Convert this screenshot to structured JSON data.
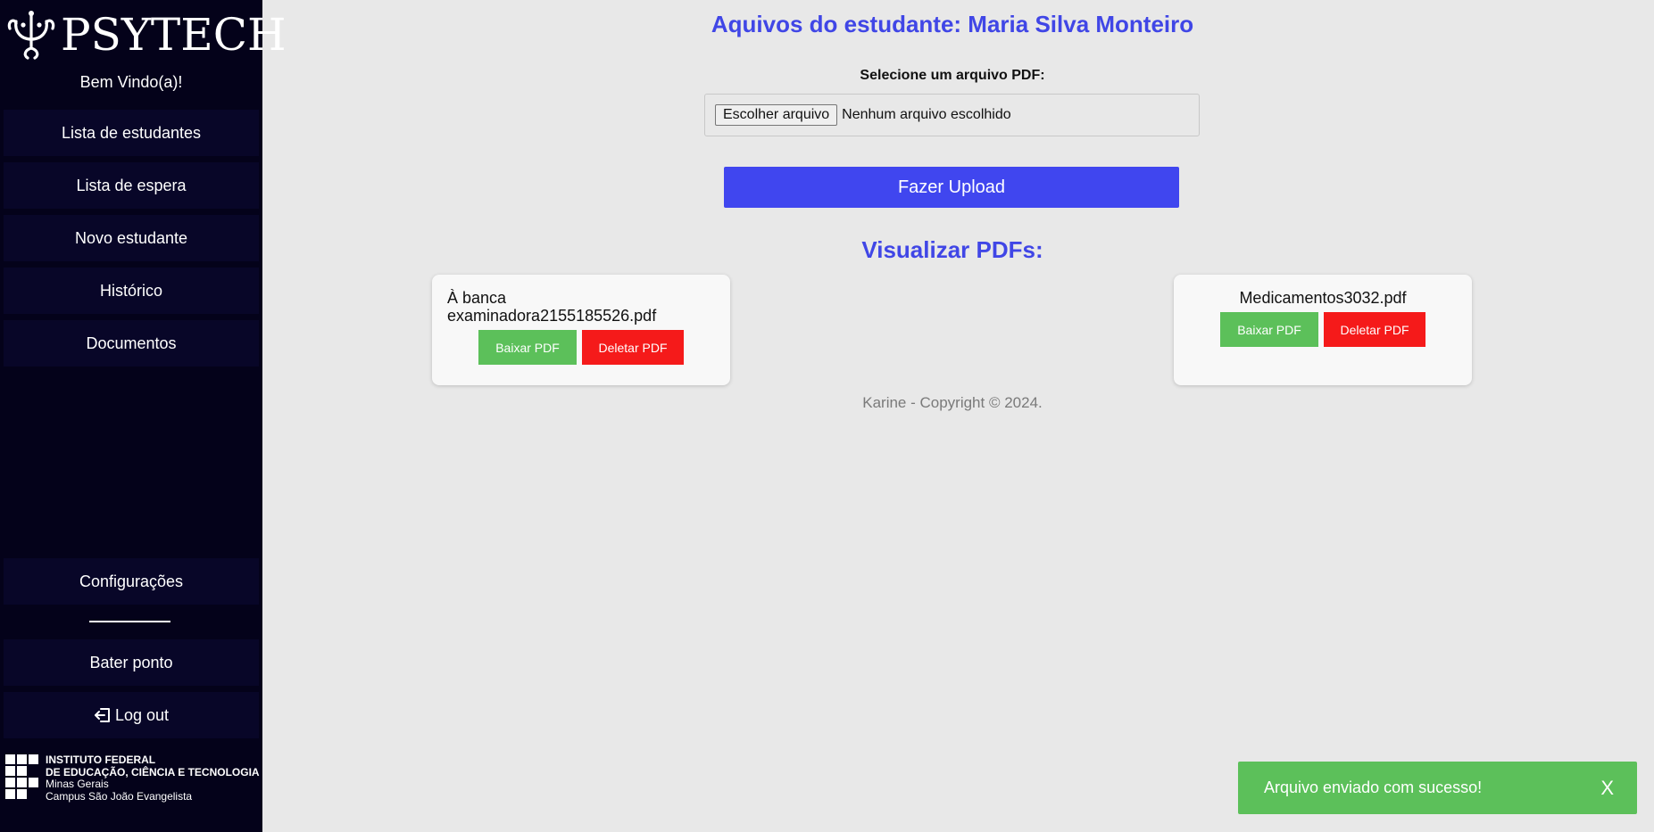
{
  "sidebar": {
    "brand": "PSYTECH",
    "welcome": "Bem Vindo(a)!",
    "nav": [
      {
        "label": "Lista de estudantes"
      },
      {
        "label": "Lista de espera"
      },
      {
        "label": "Novo estudante"
      },
      {
        "label": "Histórico"
      },
      {
        "label": "Documentos"
      }
    ],
    "settings_label": "Configurações",
    "clock_in_label": "Bater ponto",
    "logout_label": "Log out",
    "institution": {
      "line1": "INSTITUTO FEDERAL",
      "line2": "DE EDUCAÇÃO, CIÊNCIA E TECNOLOGIA",
      "line3": "Minas Gerais",
      "line4": "Campus São João Evangelista"
    }
  },
  "main": {
    "title": "Aquivos do estudante: Maria Silva Monteiro",
    "upload": {
      "label": "Selecione um arquivo PDF:",
      "choose_button": "Escolher arquivo",
      "no_file": "Nenhum arquivo escolhido",
      "submit_label": "Fazer Upload"
    },
    "pdfs_title": "Visualizar PDFs:",
    "pdfs": [
      {
        "name": "À banca examinadora2155185526.pdf",
        "download_label": "Baixar PDF",
        "delete_label": "Deletar PDF"
      },
      {
        "name": "Medicamentos3032.pdf",
        "download_label": "Baixar PDF",
        "delete_label": "Deletar PDF"
      }
    ],
    "footer": "Karine - Copyright © 2024."
  },
  "toast": {
    "message": "Arquivo enviado com sucesso!",
    "close": "X"
  },
  "colors": {
    "sidebar_bg": "#04021a",
    "accent": "#4046e6",
    "success": "#5cc05a",
    "danger": "#f51a1a"
  }
}
